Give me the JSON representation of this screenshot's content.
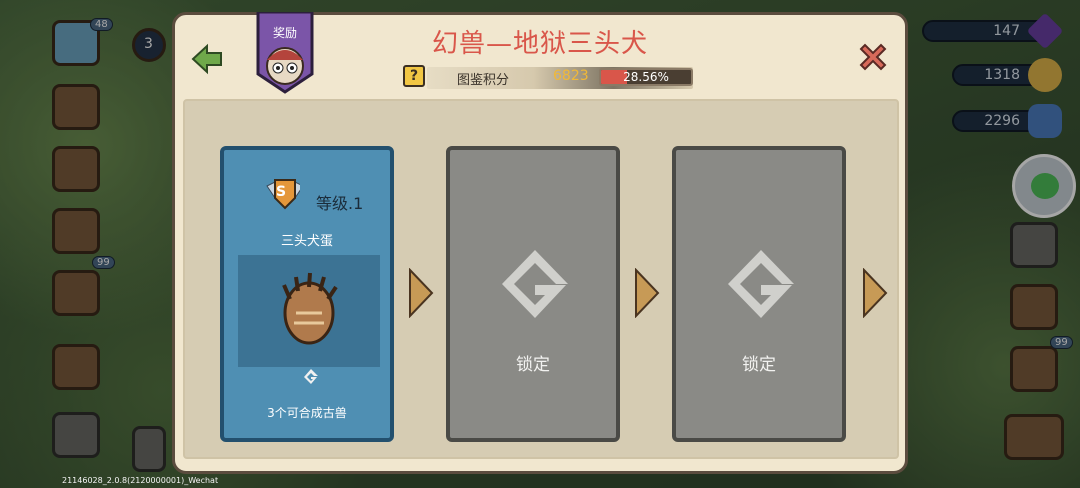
{
  "version_text": "21146028_2.0.8(2120000001)_Wechat",
  "currency": {
    "gems": "147",
    "coins": "1318",
    "blue": "2296"
  },
  "side": {
    "badge_left": "99",
    "badge_right": "99",
    "level": "3",
    "count": "48"
  },
  "panel": {
    "title": "幻兽—地狱三头犬",
    "reward_label": "奖励",
    "codex_label": "图鉴积分",
    "codex_score": "6823",
    "codex_progress_text": "28.56%",
    "codex_progress": 0.2856
  },
  "cards": [
    {
      "state": "active",
      "level_badge": "S",
      "level_text": "等级.1",
      "name": "三头犬蛋",
      "hint": "3个可合成古兽"
    },
    {
      "state": "locked",
      "label": "锁定"
    },
    {
      "state": "locked",
      "label": "锁定"
    }
  ],
  "colors": {
    "title": "#d9564a",
    "active_card": "#4f8fb3",
    "locked_card": "#8a8a86",
    "progress_fill": "#d9564a",
    "score": "#f0b838"
  }
}
